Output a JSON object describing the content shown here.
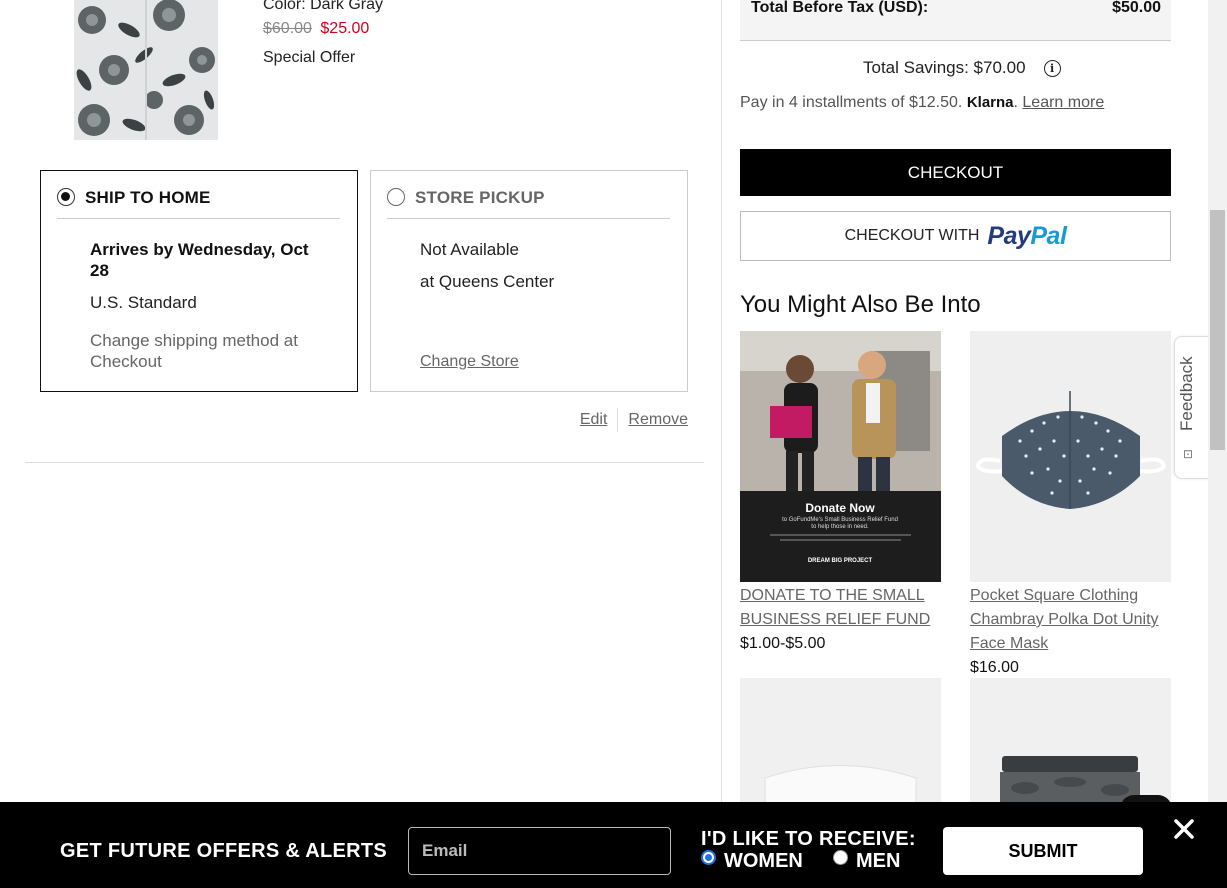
{
  "product": {
    "color": "Color: Dark Gray",
    "price_original": "$60.00",
    "price_sale": "$25.00",
    "offer": "Special Offer"
  },
  "shipping": {
    "ship_home": {
      "title": "SHIP TO HOME",
      "selected": true,
      "arrival": "Arrives by Wednesday, Oct 28",
      "method": "U.S. Standard",
      "change_note": "Change shipping method at Checkout"
    },
    "store_pickup": {
      "title": "STORE PICKUP",
      "selected": false,
      "status": "Not Available",
      "store": "at Queens Center",
      "change_link": "Change Store"
    }
  },
  "item_actions": {
    "edit": "Edit",
    "remove": "Remove"
  },
  "summary": {
    "total_label": "Total Before Tax (USD):",
    "total_value": "$50.00",
    "savings": "Total Savings: $70.00",
    "installments_text": "Pay in 4 installments of $12.50.",
    "klarna": "Klarna",
    "klarna_suffix": ".",
    "learn_more": "Learn more",
    "checkout": "CHECKOUT",
    "paypal_prefix": "CHECKOUT WITH",
    "paypal_pay": "Pay",
    "paypal_pal": "Pal"
  },
  "recommendations": {
    "title": "You Might Also Be Into",
    "items": [
      {
        "name": "DONATE TO THE SMALL BUSINESS RELIEF FUND",
        "price": "$1.00-$5.00",
        "image_heading": "Donate Now",
        "image_sub": "to GoFundMe's Small Business Relief Fund",
        "image_sub2": "to help those in need.",
        "image_brand": "DREAM BIG PROJECT"
      },
      {
        "name": "Pocket Square Clothing Chambray Polka Dot Unity Face Mask",
        "price": "$16.00"
      },
      {
        "name": "",
        "price": ""
      },
      {
        "name": "",
        "price": ""
      }
    ]
  },
  "feedback": {
    "label": "Feedback"
  },
  "offer_bar": {
    "title": "GET FUTURE OFFERS & ALERTS",
    "email_placeholder": "Email",
    "receive_label": "I'D LIKE TO RECEIVE:",
    "women": "WOMEN",
    "men": "MEN",
    "selected": "women",
    "submit": "SUBMIT"
  },
  "colors": {
    "sale_red": "#d0021b",
    "paypal_dark": "#253b80",
    "paypal_light": "#179bd7",
    "radio_blue": "#1a73e8"
  }
}
